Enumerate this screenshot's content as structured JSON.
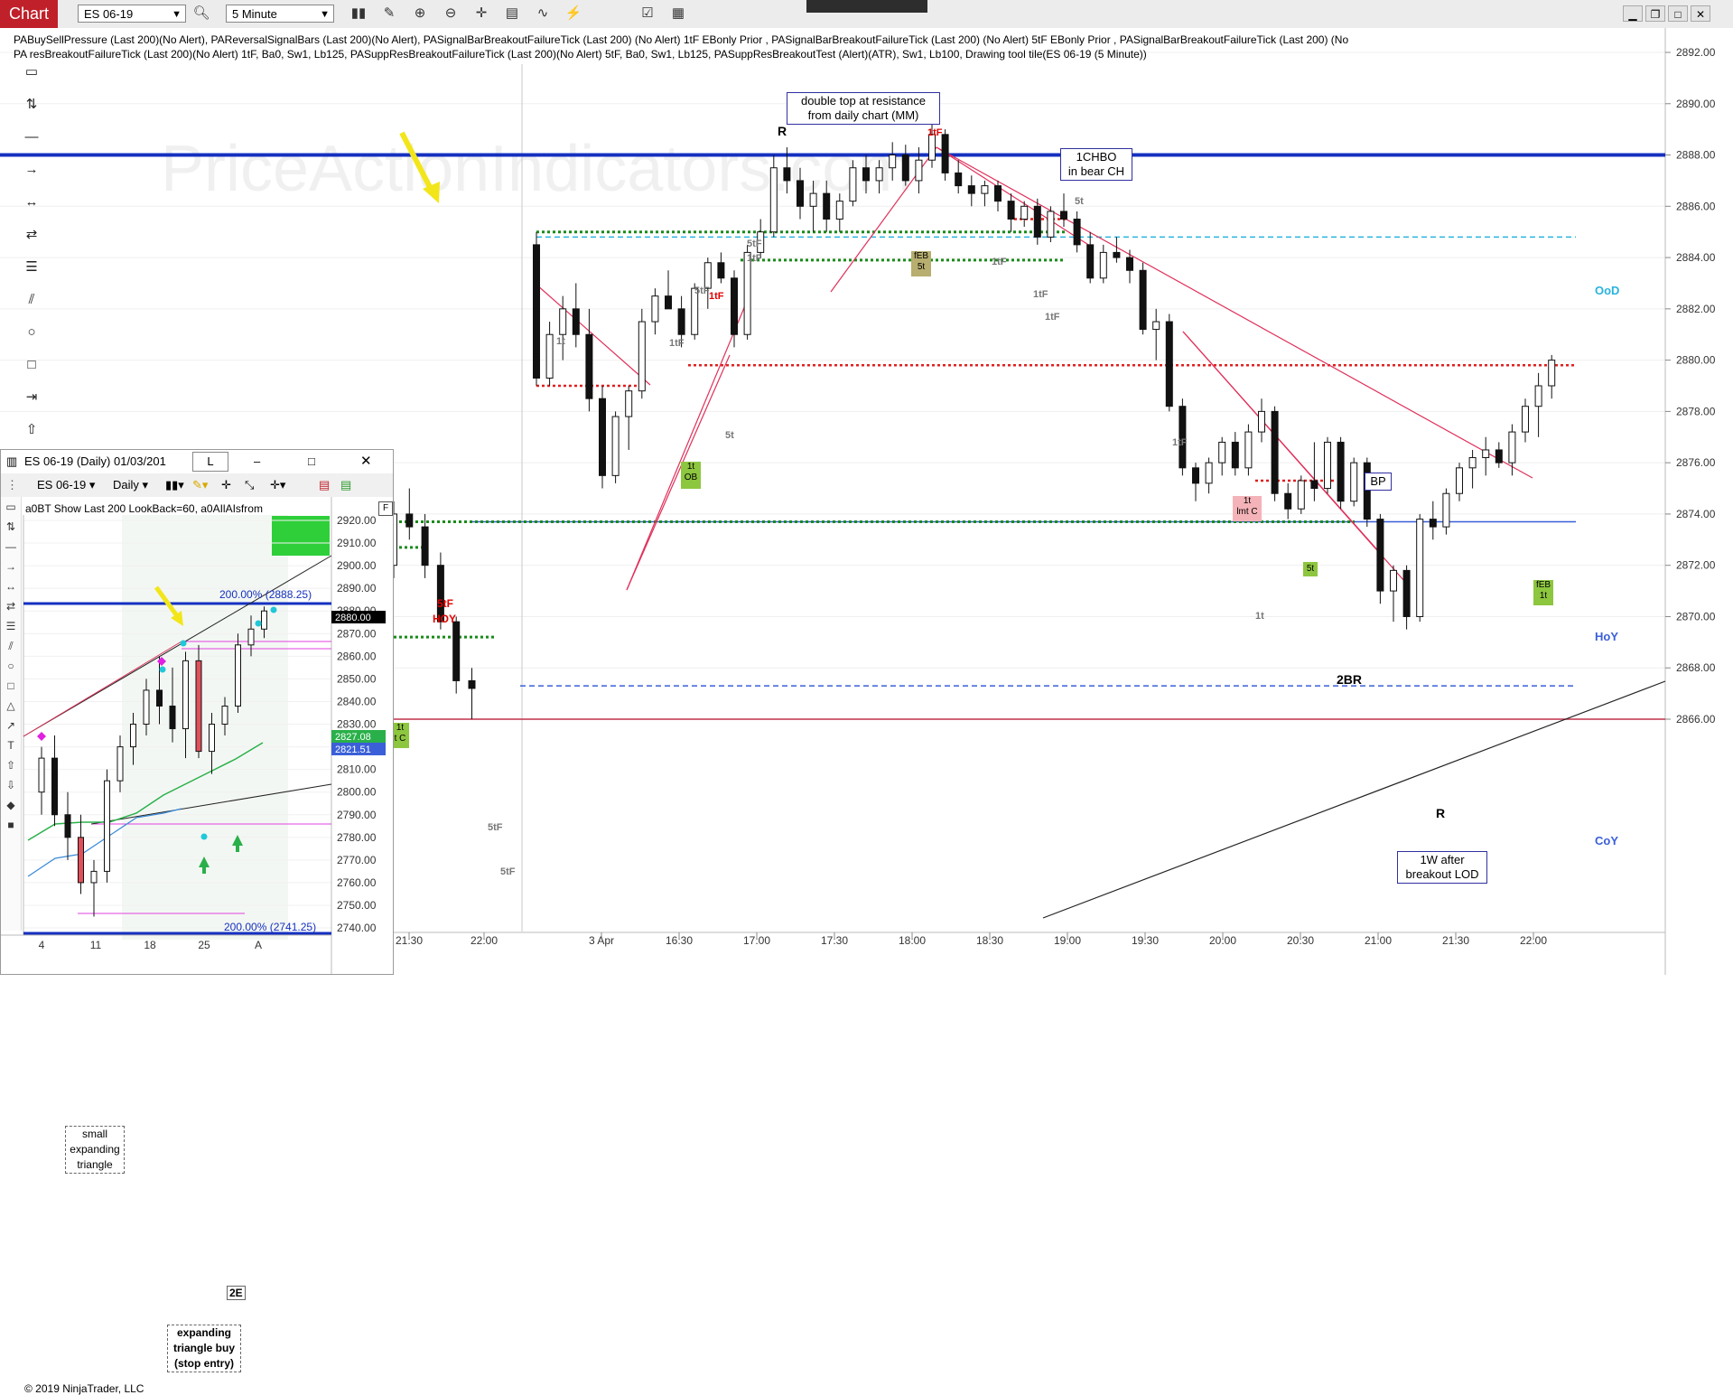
{
  "toolbar": {
    "chart_tab": "Chart",
    "instrument": "ES 06-19",
    "interval": "5 Minute"
  },
  "indicator_text": {
    "line1": "PABuySellPressure (Last 200)(No Alert), PAReversalSignalBars (Last 200)(No Alert), PASignalBarBreakoutFailureTick (Last 200) (No Alert)   1tF  EBonly  Prior  , PASignalBarBreakoutFailureTick (Last 200) (No Alert)   5tF  EBonly  Prior  , PASignalBarBreakoutFailureTick (Last 200) (No Alert)   9tF  EBonly  Prior  ,",
    "line2": "PA     resBreakoutFailureTick (Last 200)(No Alert) 1tF,  Ba0,  Sw1,  Lb125, PASuppResBreakoutFailureTick (Last 200)(No Alert) 5tF,  Ba0,  Sw1,  Lb125, PASuppResBreakoutTest (Alert)(ATR),  Sw1,  Lb100, Drawing tool tile(ES 06-19 (5 Minute))"
  },
  "watermark": "PriceActionIndicators.com",
  "price_axis": [
    "2892.00",
    "2890.00",
    "2888.00",
    "2886.00",
    "2884.00",
    "2882.00",
    "2880.00",
    "2878.00",
    "2876.00",
    "2874.00",
    "2872.00",
    "2870.00",
    "2868.00",
    "2866.00"
  ],
  "time_axis": [
    "21:30",
    "22:00",
    "3 Apr",
    "16:30",
    "17:00",
    "17:30",
    "18:00",
    "18:30",
    "19:00",
    "19:30",
    "20:00",
    "20:30",
    "21:00",
    "21:30",
    "22:00"
  ],
  "level_labels": {
    "ood": "OoD",
    "hoy": "HoY",
    "coy": "CoY"
  },
  "annotations": {
    "double_top_line1": "double top at resistance",
    "double_top_line2": "from daily chart (MM)",
    "chbo_line1": "1CHBO",
    "chbo_line2": "in bear CH",
    "bp": "BP",
    "bo_line1": "1W after",
    "bo_line2": "breakout LOD",
    "two_br": "2BR",
    "r_top": "R",
    "r_bottom": "R",
    "hoy_red_sig": "5tF",
    "hoy_red_label": "HOY"
  },
  "signals": {
    "s1t_a": "1t",
    "s5tF_a": "5tF",
    "s1tF_a": "1tF",
    "s1tF_b": "1tF",
    "s5t_a": "5t",
    "s5tF_b": "5tF",
    "s1tF_c": "1tF",
    "s1tF_d": "1tF",
    "s1tF_e": "1tF",
    "s1tF_f": "1tF",
    "s5t_b": "5t",
    "s1tF_g": "1tF",
    "s1t_b": "1t",
    "s1tF_h": "1tF",
    "s5tF_c": "5tF",
    "s5tF_d": "5tF"
  },
  "tags": {
    "feb5t_1": "fEB",
    "feb5t_2": "5t",
    "ob_1": "1t",
    "ob_2": "OB",
    "lmt_1": "1t",
    "lmt_2": "lmt C",
    "feb1t_1": "fEB",
    "feb1t_2": "1t",
    "g5t": "5t",
    "lc_1": "1t",
    "lc_2": "t C"
  },
  "mini_chart": {
    "title": "ES 06-19 (Daily)  01/03/201",
    "tab": "L",
    "instrument": "ES 06-19",
    "interval": "Daily",
    "info": "a0BT      Show  Last  200     LookBack=60,  a0AIlAIsfrom",
    "price_axis": [
      "2920.00",
      "2910.00",
      "2900.00",
      "2890.00",
      "2880.00",
      "2870.00",
      "2860.00",
      "2850.00",
      "2840.00",
      "2830.00",
      "2820.00",
      "2810.00",
      "2800.00",
      "2790.00",
      "2780.00",
      "2770.00",
      "2760.00",
      "2750.00",
      "2740.00"
    ],
    "time_axis": [
      "4",
      "11",
      "18",
      "25",
      "A"
    ],
    "level_200": "200.00% (2888.25)",
    "level_200b": "200.00% (2741.25)",
    "last_price": "2880.00",
    "green_price": "2827.08",
    "blue_price": "2821.51",
    "note1_line1": "small",
    "note1_line2": "expanding",
    "note1_line3": "triangle",
    "note2_line1": "expanding",
    "note2_line2": "triangle buy",
    "note2_line3": "(stop entry)",
    "two_e": "2E",
    "copyright": "© 2019 NinjaTrader, LLC"
  },
  "chart_data": {
    "type": "candlestick",
    "instrument": "ES 06-19",
    "interval": "5 Minute",
    "ylim": [
      2865,
      2892.5
    ],
    "levels": {
      "resistance": 2888.0,
      "OoD": 2884.8,
      "HoY": 2873.7,
      "CoY": 2867.3,
      "LOD": 2866.0,
      "prior_close_red": 2879.8
    },
    "bars": [
      [
        2872.0,
        2874.5,
        2871.5,
        2874.0
      ],
      [
        2874.0,
        2875.0,
        2873.0,
        2873.5
      ],
      [
        2873.5,
        2874.0,
        2871.5,
        2872.0
      ],
      [
        2872.0,
        2872.5,
        2869.5,
        2869.8
      ],
      [
        2869.8,
        2870.0,
        2867.0,
        2867.5
      ],
      [
        2867.5,
        2868.0,
        2866.0,
        2867.2
      ],
      [
        2884.5,
        2885.0,
        2879.0,
        2879.3
      ],
      [
        2879.3,
        2881.5,
        2879.0,
        2881.0
      ],
      [
        2881.0,
        2882.5,
        2880.0,
        2882.0
      ],
      [
        2882.0,
        2883.0,
        2880.5,
        2881.0
      ],
      [
        2881.0,
        2882.0,
        2878.0,
        2878.5
      ],
      [
        2878.5,
        2879.0,
        2875.0,
        2875.5
      ],
      [
        2875.5,
        2878.0,
        2875.2,
        2877.8
      ],
      [
        2877.8,
        2879.0,
        2876.5,
        2878.8
      ],
      [
        2878.8,
        2882.0,
        2878.5,
        2881.5
      ],
      [
        2881.5,
        2882.8,
        2881.0,
        2882.5
      ],
      [
        2882.5,
        2883.5,
        2882.0,
        2882.0
      ],
      [
        2882.0,
        2882.5,
        2880.5,
        2881.0
      ],
      [
        2881.0,
        2883.0,
        2880.8,
        2882.8
      ],
      [
        2882.8,
        2884.0,
        2882.0,
        2883.8
      ],
      [
        2883.8,
        2884.2,
        2883.0,
        2883.2
      ],
      [
        2883.2,
        2883.5,
        2880.5,
        2881.0
      ],
      [
        2881.0,
        2884.5,
        2880.8,
        2884.2
      ],
      [
        2884.2,
        2885.5,
        2884.0,
        2885.0
      ],
      [
        2885.0,
        2888.0,
        2884.8,
        2887.5
      ],
      [
        2887.5,
        2888.3,
        2886.5,
        2887.0
      ],
      [
        2887.0,
        2887.5,
        2885.5,
        2886.0
      ],
      [
        2886.0,
        2887.0,
        2885.0,
        2886.5
      ],
      [
        2886.5,
        2887.0,
        2885.0,
        2885.5
      ],
      [
        2885.5,
        2886.5,
        2885.0,
        2886.2
      ],
      [
        2886.2,
        2887.8,
        2886.0,
        2887.5
      ],
      [
        2887.5,
        2888.0,
        2886.5,
        2887.0
      ],
      [
        2887.0,
        2887.8,
        2886.5,
        2887.5
      ],
      [
        2887.5,
        2888.5,
        2887.0,
        2888.0
      ],
      [
        2888.0,
        2888.4,
        2886.8,
        2887.0
      ],
      [
        2887.0,
        2888.3,
        2886.5,
        2887.8
      ],
      [
        2887.8,
        2889.2,
        2887.5,
        2888.8
      ],
      [
        2888.8,
        2889.0,
        2887.0,
        2887.3
      ],
      [
        2887.3,
        2887.8,
        2886.5,
        2886.8
      ],
      [
        2886.8,
        2887.2,
        2886.0,
        2886.5
      ],
      [
        2886.5,
        2887.0,
        2886.0,
        2886.8
      ],
      [
        2886.8,
        2887.0,
        2885.8,
        2886.2
      ],
      [
        2886.2,
        2886.5,
        2885.0,
        2885.5
      ],
      [
        2885.5,
        2886.2,
        2885.2,
        2886.0
      ],
      [
        2886.0,
        2886.3,
        2884.5,
        2884.8
      ],
      [
        2884.8,
        2886.0,
        2884.6,
        2885.8
      ],
      [
        2885.8,
        2886.5,
        2885.2,
        2885.5
      ],
      [
        2885.5,
        2885.8,
        2884.2,
        2884.5
      ],
      [
        2884.5,
        2885.0,
        2883.0,
        2883.2
      ],
      [
        2883.2,
        2884.5,
        2883.0,
        2884.2
      ],
      [
        2884.2,
        2884.8,
        2883.8,
        2884.0
      ],
      [
        2884.0,
        2884.3,
        2883.0,
        2883.5
      ],
      [
        2883.5,
        2883.8,
        2881.0,
        2881.2
      ],
      [
        2881.2,
        2882.0,
        2880.0,
        2881.5
      ],
      [
        2881.5,
        2881.8,
        2878.0,
        2878.2
      ],
      [
        2878.2,
        2878.5,
        2875.5,
        2875.8
      ],
      [
        2875.8,
        2876.0,
        2874.5,
        2875.2
      ],
      [
        2875.2,
        2876.2,
        2874.8,
        2876.0
      ],
      [
        2876.0,
        2877.0,
        2875.5,
        2876.8
      ],
      [
        2876.8,
        2877.2,
        2875.5,
        2875.8
      ],
      [
        2875.8,
        2877.5,
        2875.5,
        2877.2
      ],
      [
        2877.2,
        2878.5,
        2876.8,
        2878.0
      ],
      [
        2878.0,
        2878.2,
        2874.5,
        2874.8
      ],
      [
        2874.8,
        2875.2,
        2873.8,
        2874.2
      ],
      [
        2874.2,
        2875.5,
        2874.0,
        2875.3
      ],
      [
        2875.3,
        2876.8,
        2874.5,
        2875.0
      ],
      [
        2875.0,
        2877.0,
        2874.8,
        2876.8
      ],
      [
        2876.8,
        2877.0,
        2874.2,
        2874.5
      ],
      [
        2874.5,
        2876.2,
        2874.3,
        2876.0
      ],
      [
        2876.0,
        2876.2,
        2873.5,
        2873.8
      ],
      [
        2873.8,
        2874.0,
        2870.5,
        2871.0
      ],
      [
        2871.0,
        2872.0,
        2869.8,
        2871.8
      ],
      [
        2871.8,
        2872.0,
        2869.5,
        2870.0
      ],
      [
        2870.0,
        2874.0,
        2869.8,
        2873.8
      ],
      [
        2873.8,
        2874.5,
        2873.0,
        2873.5
      ],
      [
        2873.5,
        2875.0,
        2873.2,
        2874.8
      ],
      [
        2874.8,
        2876.0,
        2874.5,
        2875.8
      ],
      [
        2875.8,
        2876.5,
        2875.0,
        2876.2
      ],
      [
        2876.2,
        2877.0,
        2875.5,
        2876.5
      ],
      [
        2876.5,
        2876.8,
        2875.8,
        2876.0
      ],
      [
        2876.0,
        2877.5,
        2875.5,
        2877.2
      ],
      [
        2877.2,
        2878.5,
        2876.8,
        2878.2
      ],
      [
        2878.2,
        2879.5,
        2877.0,
        2879.0
      ],
      [
        2879.0,
        2880.2,
        2878.5,
        2880.0
      ]
    ]
  }
}
